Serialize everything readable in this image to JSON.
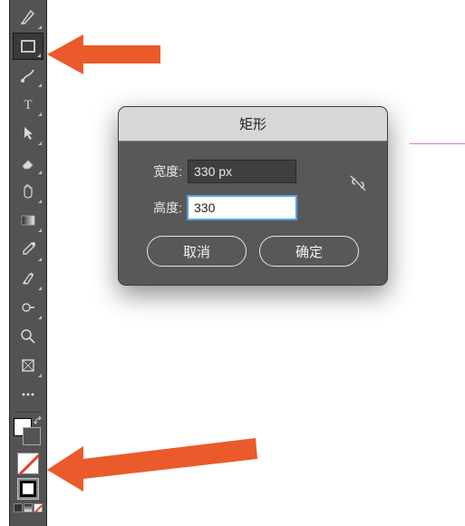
{
  "toolbar": {
    "tools": [
      {
        "name": "pen-tool"
      },
      {
        "name": "rectangle-tool",
        "selected": true
      },
      {
        "name": "brush-tool"
      },
      {
        "name": "type-tool"
      },
      {
        "name": "path-selection-tool"
      },
      {
        "name": "eraser-tool"
      },
      {
        "name": "hand-tool"
      },
      {
        "name": "gradient-tool"
      },
      {
        "name": "eyedropper-tool"
      },
      {
        "name": "healing-brush-tool"
      },
      {
        "name": "dodge-tool"
      },
      {
        "name": "zoom-tool"
      },
      {
        "name": "frame-tool"
      },
      {
        "name": "more-tool"
      }
    ]
  },
  "dialog": {
    "title": "矩形",
    "width_label": "宽度:",
    "width_value": "330 px",
    "height_label": "高度:",
    "height_value": "330",
    "cancel_label": "取消",
    "ok_label": "确定"
  }
}
